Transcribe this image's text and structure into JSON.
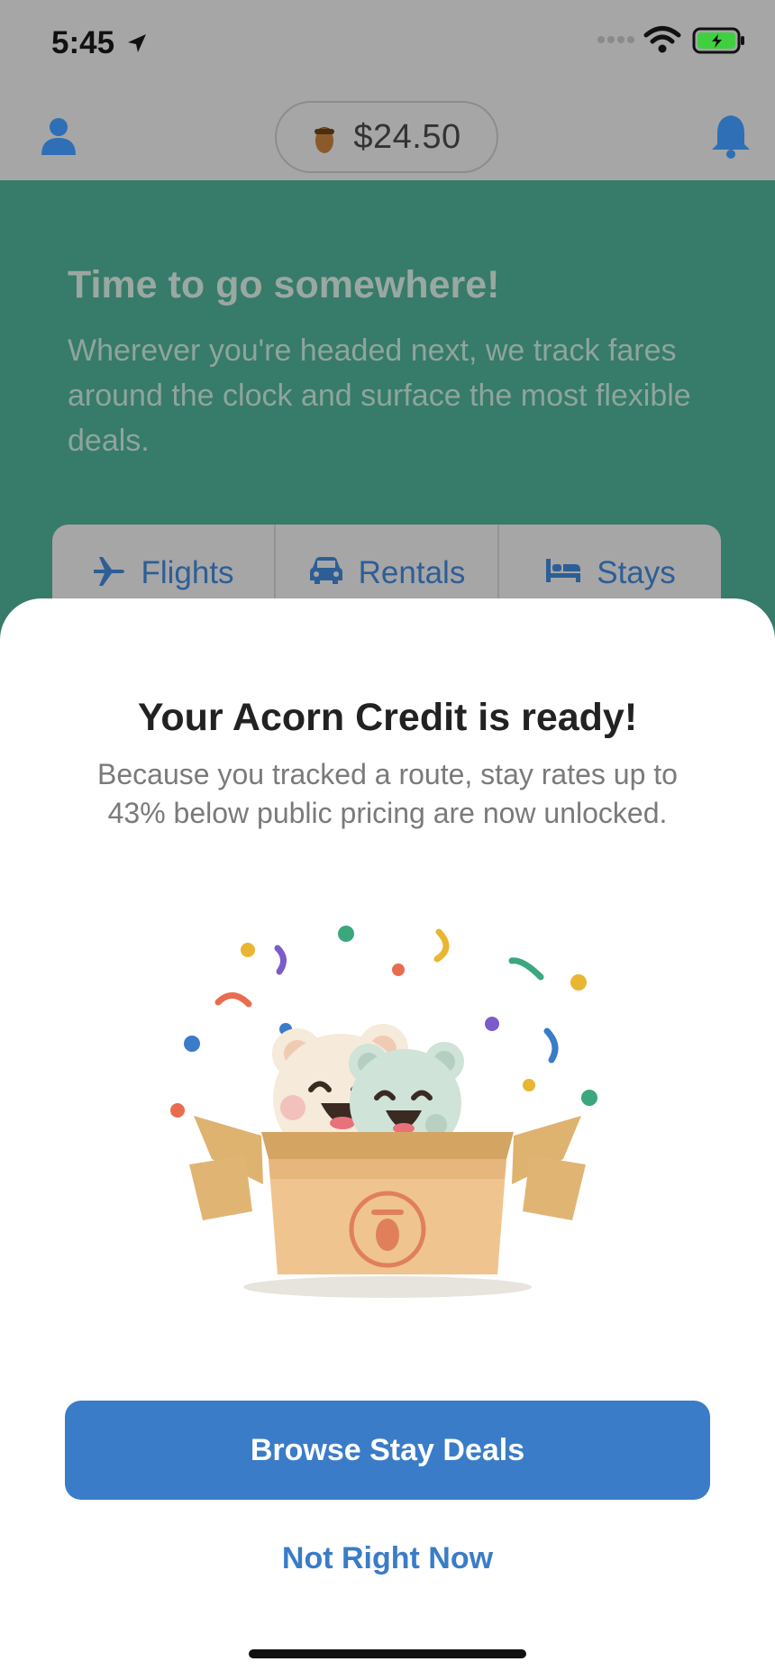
{
  "status_bar": {
    "time": "5:45",
    "icons": [
      "location-arrow-icon",
      "signal-icon",
      "wifi-icon",
      "battery-charging-icon"
    ]
  },
  "header": {
    "balance": "$24.50",
    "icons": {
      "profile": "person-icon",
      "balance": "acorn-icon",
      "notifications": "bell-icon"
    }
  },
  "hero": {
    "title": "Time to go somewhere!",
    "subtitle": "Wherever you're headed next, we track fares around the clock and surface the most flexible deals."
  },
  "tabs": [
    {
      "label": "Flights",
      "icon": "airplane-icon"
    },
    {
      "label": "Rentals",
      "icon": "car-icon"
    },
    {
      "label": "Stays",
      "icon": "bed-icon"
    }
  ],
  "sheet": {
    "title": "Your Acorn Credit is ready!",
    "body": "Because you tracked a route, stay rates up to 43% below public pricing are now unlocked.",
    "illustration": "bears-in-box-confetti-illustration",
    "primary_button": "Browse Stay Deals",
    "secondary_button": "Not Right Now"
  },
  "colors": {
    "accent": "#3a7cc7",
    "hero_green": "#377b6a",
    "overlay_gray": "#a6a6a6"
  }
}
